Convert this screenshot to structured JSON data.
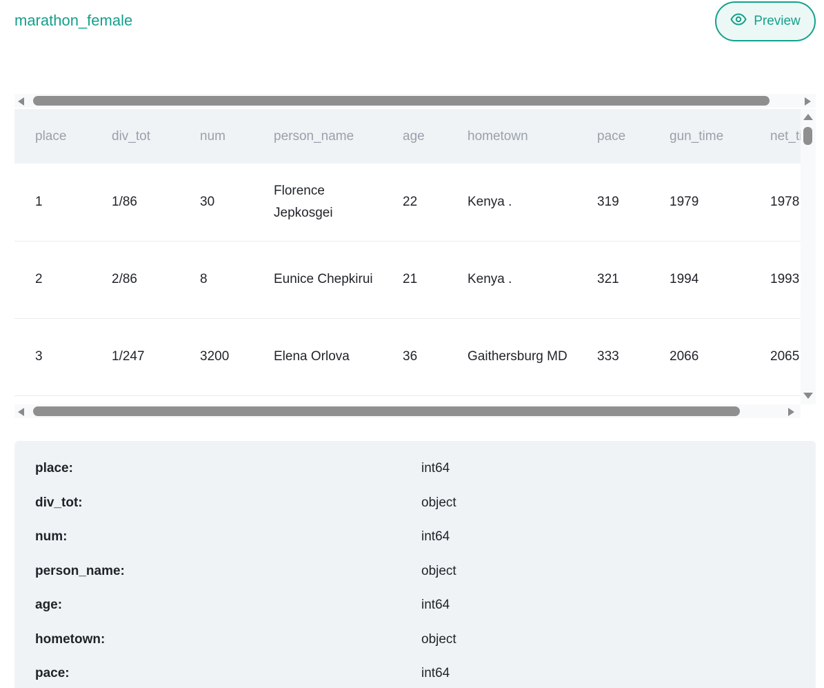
{
  "dataset_title": "marathon_female",
  "preview_button_label": "Preview",
  "table": {
    "columns": [
      "place",
      "div_tot",
      "num",
      "person_name",
      "age",
      "hometown",
      "pace",
      "gun_time",
      "net_time"
    ],
    "rows": [
      [
        "1",
        "1/86",
        "30",
        "Florence Jepkosgei",
        "22",
        "Kenya .",
        "319",
        "1979",
        "1978"
      ],
      [
        "2",
        "2/86",
        "8",
        "Eunice Chepkirui",
        "21",
        "Kenya .",
        "321",
        "1994",
        "1993"
      ],
      [
        "3",
        "1/247",
        "3200",
        "Elena Orlova",
        "36",
        "Gaithersburg MD",
        "333",
        "2066",
        "2065"
      ]
    ]
  },
  "dtypes": [
    {
      "name": "place:",
      "type": "int64"
    },
    {
      "name": "div_tot:",
      "type": "object"
    },
    {
      "name": "num:",
      "type": "int64"
    },
    {
      "name": "person_name:",
      "type": "object"
    },
    {
      "name": "age:",
      "type": "int64"
    },
    {
      "name": "hometown:",
      "type": "object"
    },
    {
      "name": "pace:",
      "type": "int64"
    }
  ],
  "colors": {
    "accent": "#14a08c",
    "header_bg": "#f0f3f6",
    "header_text": "#9aa1ab"
  },
  "icons": {
    "preview": "eye-icon"
  }
}
